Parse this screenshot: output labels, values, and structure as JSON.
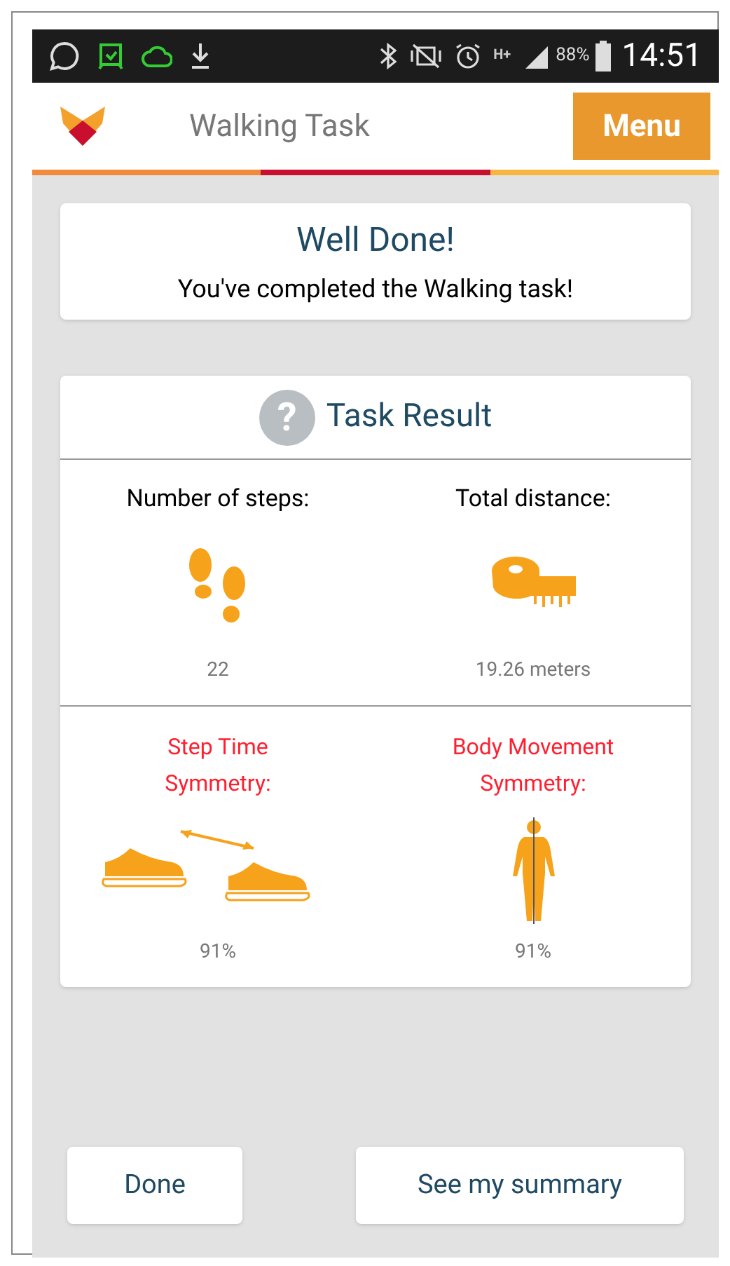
{
  "status_bar": {
    "network": "H+",
    "battery": "88%",
    "time": "14:51"
  },
  "header": {
    "title": "Walking Task",
    "menu": "Menu"
  },
  "message": {
    "title": "Well Done!",
    "text": "You've completed the Walking task!"
  },
  "result": {
    "help": "?",
    "title": "Task Result",
    "metrics": [
      {
        "kind": "steps",
        "label": "Number of steps:",
        "value": "22",
        "alert": false
      },
      {
        "kind": "distance",
        "label": "Total distance:",
        "value": "19.26 meters",
        "alert": false
      },
      {
        "kind": "shoes",
        "label": "Step Time Symmetry:",
        "value": "91%",
        "alert": true
      },
      {
        "kind": "body",
        "label": "Body Movement Symmetry:",
        "value": "91%",
        "alert": true
      }
    ]
  },
  "buttons": [
    "Done",
    "See my summary"
  ]
}
